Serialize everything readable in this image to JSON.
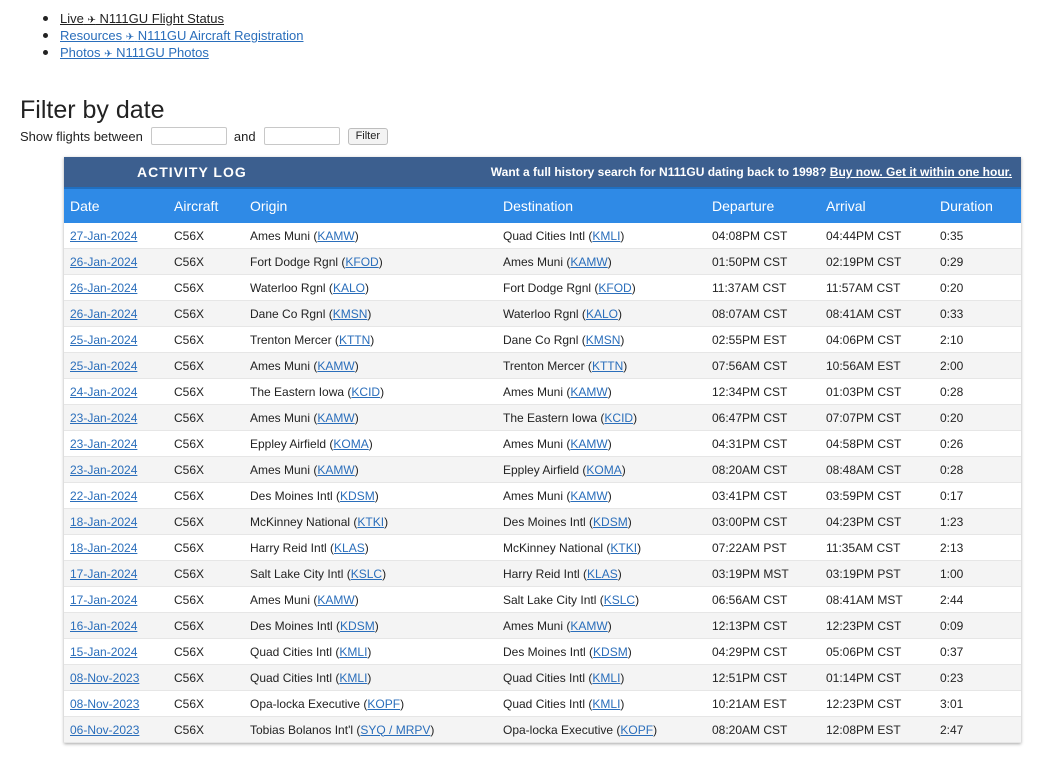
{
  "nav": [
    {
      "section": "Live",
      "arrow": "✈",
      "text": "N111GU Flight Status"
    },
    {
      "section": "Resources",
      "arrow": "✈",
      "text": "N111GU Aircraft Registration"
    },
    {
      "section": "Photos",
      "arrow": "✈",
      "text": "N111GU Photos"
    }
  ],
  "filter": {
    "title": "Filter by date",
    "label_between": "Show flights between",
    "label_and": "and",
    "from_value": "",
    "to_value": "",
    "button": "Filter"
  },
  "log": {
    "title": "ACTIVITY LOG",
    "promo_text": "Want a full history search for N111GU dating back to 1998?",
    "promo_link": "Buy now. Get it within one hour.",
    "columns": [
      "Date",
      "Aircraft",
      "Origin",
      "Destination",
      "Departure",
      "Arrival",
      "Duration"
    ],
    "rows": [
      {
        "date": "27-Jan-2024",
        "aircraft": "C56X",
        "origin_name": "Ames Muni",
        "origin_code": "KAMW",
        "dest_name": "Quad Cities Intl",
        "dest_code": "KMLI",
        "departure": "04:08PM CST",
        "arrival": "04:44PM CST",
        "duration": "0:35"
      },
      {
        "date": "26-Jan-2024",
        "aircraft": "C56X",
        "origin_name": "Fort Dodge Rgnl",
        "origin_code": "KFOD",
        "dest_name": "Ames Muni",
        "dest_code": "KAMW",
        "departure": "01:50PM CST",
        "arrival": "02:19PM CST",
        "duration": "0:29"
      },
      {
        "date": "26-Jan-2024",
        "aircraft": "C56X",
        "origin_name": "Waterloo Rgnl",
        "origin_code": "KALO",
        "dest_name": "Fort Dodge Rgnl",
        "dest_code": "KFOD",
        "departure": "11:37AM CST",
        "arrival": "11:57AM CST",
        "duration": "0:20"
      },
      {
        "date": "26-Jan-2024",
        "aircraft": "C56X",
        "origin_name": "Dane Co Rgnl",
        "origin_code": "KMSN",
        "dest_name": "Waterloo Rgnl",
        "dest_code": "KALO",
        "departure": "08:07AM CST",
        "arrival": "08:41AM CST",
        "duration": "0:33"
      },
      {
        "date": "25-Jan-2024",
        "aircraft": "C56X",
        "origin_name": "Trenton Mercer",
        "origin_code": "KTTN",
        "dest_name": "Dane Co Rgnl",
        "dest_code": "KMSN",
        "departure": "02:55PM EST",
        "arrival": "04:06PM CST",
        "duration": "2:10"
      },
      {
        "date": "25-Jan-2024",
        "aircraft": "C56X",
        "origin_name": "Ames Muni",
        "origin_code": "KAMW",
        "dest_name": "Trenton Mercer",
        "dest_code": "KTTN",
        "departure": "07:56AM CST",
        "arrival": "10:56AM EST",
        "duration": "2:00"
      },
      {
        "date": "24-Jan-2024",
        "aircraft": "C56X",
        "origin_name": "The Eastern Iowa",
        "origin_code": "KCID",
        "dest_name": "Ames Muni",
        "dest_code": "KAMW",
        "departure": "12:34PM CST",
        "arrival": "01:03PM CST",
        "duration": "0:28"
      },
      {
        "date": "23-Jan-2024",
        "aircraft": "C56X",
        "origin_name": "Ames Muni",
        "origin_code": "KAMW",
        "dest_name": "The Eastern Iowa",
        "dest_code": "KCID",
        "departure": "06:47PM CST",
        "arrival": "07:07PM CST",
        "duration": "0:20"
      },
      {
        "date": "23-Jan-2024",
        "aircraft": "C56X",
        "origin_name": "Eppley Airfield",
        "origin_code": "KOMA",
        "dest_name": "Ames Muni",
        "dest_code": "KAMW",
        "departure": "04:31PM CST",
        "arrival": "04:58PM CST",
        "duration": "0:26"
      },
      {
        "date": "23-Jan-2024",
        "aircraft": "C56X",
        "origin_name": "Ames Muni",
        "origin_code": "KAMW",
        "dest_name": "Eppley Airfield",
        "dest_code": "KOMA",
        "departure": "08:20AM CST",
        "arrival": "08:48AM CST",
        "duration": "0:28"
      },
      {
        "date": "22-Jan-2024",
        "aircraft": "C56X",
        "origin_name": "Des Moines Intl",
        "origin_code": "KDSM",
        "dest_name": "Ames Muni",
        "dest_code": "KAMW",
        "departure": "03:41PM CST",
        "arrival": "03:59PM CST",
        "duration": "0:17"
      },
      {
        "date": "18-Jan-2024",
        "aircraft": "C56X",
        "origin_name": "McKinney National",
        "origin_code": "KTKI",
        "dest_name": "Des Moines Intl",
        "dest_code": "KDSM",
        "departure": "03:00PM CST",
        "arrival": "04:23PM CST",
        "duration": "1:23"
      },
      {
        "date": "18-Jan-2024",
        "aircraft": "C56X",
        "origin_name": "Harry Reid Intl",
        "origin_code": "KLAS",
        "dest_name": "McKinney National",
        "dest_code": "KTKI",
        "departure": "07:22AM PST",
        "arrival": "11:35AM CST",
        "duration": "2:13"
      },
      {
        "date": "17-Jan-2024",
        "aircraft": "C56X",
        "origin_name": "Salt Lake City Intl",
        "origin_code": "KSLC",
        "dest_name": "Harry Reid Intl",
        "dest_code": "KLAS",
        "departure": "03:19PM MST",
        "arrival": "03:19PM PST",
        "duration": "1:00"
      },
      {
        "date": "17-Jan-2024",
        "aircraft": "C56X",
        "origin_name": "Ames Muni",
        "origin_code": "KAMW",
        "dest_name": "Salt Lake City Intl",
        "dest_code": "KSLC",
        "departure": "06:56AM CST",
        "arrival": "08:41AM MST",
        "duration": "2:44"
      },
      {
        "date": "16-Jan-2024",
        "aircraft": "C56X",
        "origin_name": "Des Moines Intl",
        "origin_code": "KDSM",
        "dest_name": "Ames Muni",
        "dest_code": "KAMW",
        "departure": "12:13PM CST",
        "arrival": "12:23PM CST",
        "duration": "0:09"
      },
      {
        "date": "15-Jan-2024",
        "aircraft": "C56X",
        "origin_name": "Quad Cities Intl",
        "origin_code": "KMLI",
        "dest_name": "Des Moines Intl",
        "dest_code": "KDSM",
        "departure": "04:29PM CST",
        "arrival": "05:06PM CST",
        "duration": "0:37"
      },
      {
        "date": "08-Nov-2023",
        "aircraft": "C56X",
        "origin_name": "Quad Cities Intl",
        "origin_code": "KMLI",
        "dest_name": "Quad Cities Intl",
        "dest_code": "KMLI",
        "departure": "12:51PM CST",
        "arrival": "01:14PM CST",
        "duration": "0:23"
      },
      {
        "date": "08-Nov-2023",
        "aircraft": "C56X",
        "origin_name": "Opa-locka Executive",
        "origin_code": "KOPF",
        "dest_name": "Quad Cities Intl",
        "dest_code": "KMLI",
        "departure": "10:21AM EST",
        "arrival": "12:23PM CST",
        "duration": "3:01"
      },
      {
        "date": "06-Nov-2023",
        "aircraft": "C56X",
        "origin_name": "Tobias Bolanos Int'l",
        "origin_code": "SYQ / MRPV",
        "dest_name": "Opa-locka Executive",
        "dest_code": "KOPF",
        "departure": "08:20AM CST",
        "arrival": "12:08PM EST",
        "duration": "2:47"
      }
    ]
  }
}
